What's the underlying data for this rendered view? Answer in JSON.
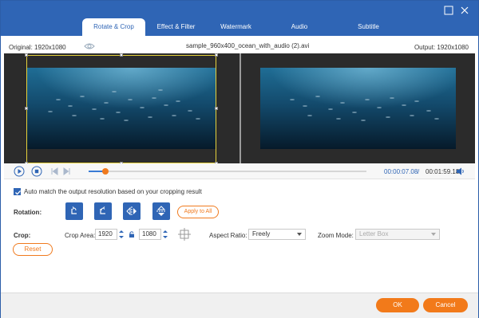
{
  "tabs": [
    {
      "label": "Rotate & Crop",
      "active": true
    },
    {
      "label": "Effect & Filter",
      "active": false
    },
    {
      "label": "Watermark",
      "active": false
    },
    {
      "label": "Audio",
      "active": false
    },
    {
      "label": "Subtitle",
      "active": false
    }
  ],
  "window_controls": {
    "minimize_icon": "minimize-icon",
    "close_icon": "close-icon"
  },
  "info": {
    "original": "Original: 1920x1080",
    "filename": "sample_960x400_ocean_with_audio (2).avi",
    "output": "Output: 1920x1080"
  },
  "playback": {
    "current_time": "00:00:07.08",
    "separator": "/",
    "total_time": "00:01:59.18",
    "progress_fraction": 0.06
  },
  "settings": {
    "auto_match_label": "Auto match the output resolution based on your cropping result",
    "auto_match_checked": true,
    "rotation_label": "Rotation:",
    "rotation_buttons": [
      "rotate-left-icon",
      "rotate-right-icon",
      "flip-horizontal-icon",
      "flip-vertical-icon"
    ],
    "apply_all_label": "Apply to All",
    "crop_label": "Crop:",
    "crop_area_label": "Crop Area:",
    "crop_width": "1920",
    "crop_height": "1080",
    "aspect_ratio_label": "Aspect Ratio:",
    "aspect_ratio_value": "Freely",
    "zoom_mode_label": "Zoom Mode:",
    "zoom_mode_value": "Letter Box",
    "reset_label": "Reset"
  },
  "footer": {
    "ok_label": "OK",
    "cancel_label": "Cancel"
  },
  "colors": {
    "primary": "#2f65b5",
    "accent": "#f07a1e",
    "crop_frame": "#e6d23c"
  }
}
